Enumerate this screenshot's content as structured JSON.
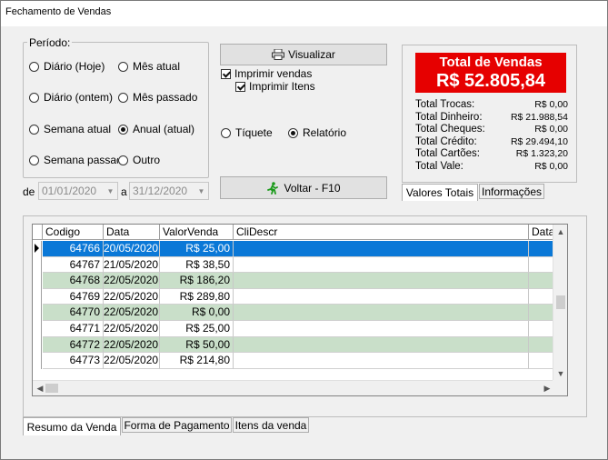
{
  "window": {
    "title": "Fechamento de Vendas"
  },
  "periodo": {
    "legend": "Período:",
    "options": [
      {
        "label": "Diário (Hoje)",
        "selected": false
      },
      {
        "label": "Mês atual",
        "selected": false
      },
      {
        "label": "Diário (ontem)",
        "selected": false
      },
      {
        "label": "Mês passado",
        "selected": false
      },
      {
        "label": "Semana atual",
        "selected": false
      },
      {
        "label": "Anual (atual)",
        "selected": true
      },
      {
        "label": "Semana passada",
        "selected": false
      },
      {
        "label": "Outro",
        "selected": false
      }
    ]
  },
  "range": {
    "from_label": "de",
    "to_label": "a",
    "from": "01/01/2020",
    "to": "31/12/2020"
  },
  "actions": {
    "visualizar": "Visualizar",
    "imprimir_vendas": "Imprimir vendas",
    "imprimir_itens": "Imprimir Itens",
    "tiquete": "Tíquete",
    "relatorio": "Relatório",
    "voltar": "Voltar - F10"
  },
  "totals": {
    "title": "Total de Vendas",
    "total": "R$  52.805,84",
    "rows": [
      {
        "label": "Total Trocas:",
        "value": "R$  0,00"
      },
      {
        "label": "Total Dinheiro:",
        "value": "R$  21.988,54"
      },
      {
        "label": "Total Cheques:",
        "value": "R$  0,00"
      },
      {
        "label": "Total Crédito:",
        "value": "R$  29.494,10"
      },
      {
        "label": "Total Cartões:",
        "value": "R$  1.323,20"
      },
      {
        "label": "Total Vale:",
        "value": "R$  0,00"
      }
    ],
    "tabs": [
      "Valores Totais",
      "Informações"
    ]
  },
  "grid": {
    "columns": [
      "Codigo",
      "Data",
      "ValorVenda",
      "CliDescr",
      "DataF"
    ],
    "rows": [
      [
        "64766",
        "20/05/2020",
        "R$  25,00",
        ""
      ],
      [
        "64767",
        "21/05/2020",
        "R$  38,50",
        ""
      ],
      [
        "64768",
        "22/05/2020",
        "R$  186,20",
        ""
      ],
      [
        "64769",
        "22/05/2020",
        "R$  289,80",
        ""
      ],
      [
        "64770",
        "22/05/2020",
        "R$  0,00",
        ""
      ],
      [
        "64771",
        "22/05/2020",
        "R$  25,00",
        ""
      ],
      [
        "64772",
        "22/05/2020",
        "R$  50,00",
        ""
      ],
      [
        "64773",
        "22/05/2020",
        "R$  214,80",
        ""
      ]
    ]
  },
  "bottom_tabs": [
    "Resumo da Venda",
    "Forma de Pagamento",
    "Itens da venda"
  ],
  "colors": {
    "selected_row": "#0a78d7",
    "alt_row": "#c9dfc9",
    "red": "#e60000"
  }
}
